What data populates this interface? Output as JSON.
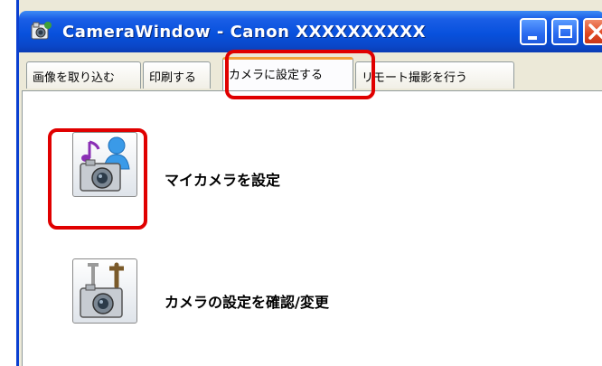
{
  "window": {
    "title": "CameraWindow - Canon XXXXXXXXXX",
    "title_bar_color": "#0a47c8",
    "controls": [
      "minimize-icon",
      "maximize-icon",
      "close-icon"
    ]
  },
  "tabs": [
    {
      "label": "画像を取り込む",
      "active": false
    },
    {
      "label": "印刷する",
      "active": false
    },
    {
      "label": "カメラに設定する",
      "active": true
    },
    {
      "label": "リモート撮影を行う",
      "active": false
    }
  ],
  "actions": [
    {
      "label": "マイカメラを設定",
      "icon": "my-camera-icon"
    },
    {
      "label": "カメラの設定を確認/変更",
      "icon": "camera-settings-icon"
    }
  ],
  "annotation_color": "#e00000",
  "active_tab_accent": "#f2a33a"
}
